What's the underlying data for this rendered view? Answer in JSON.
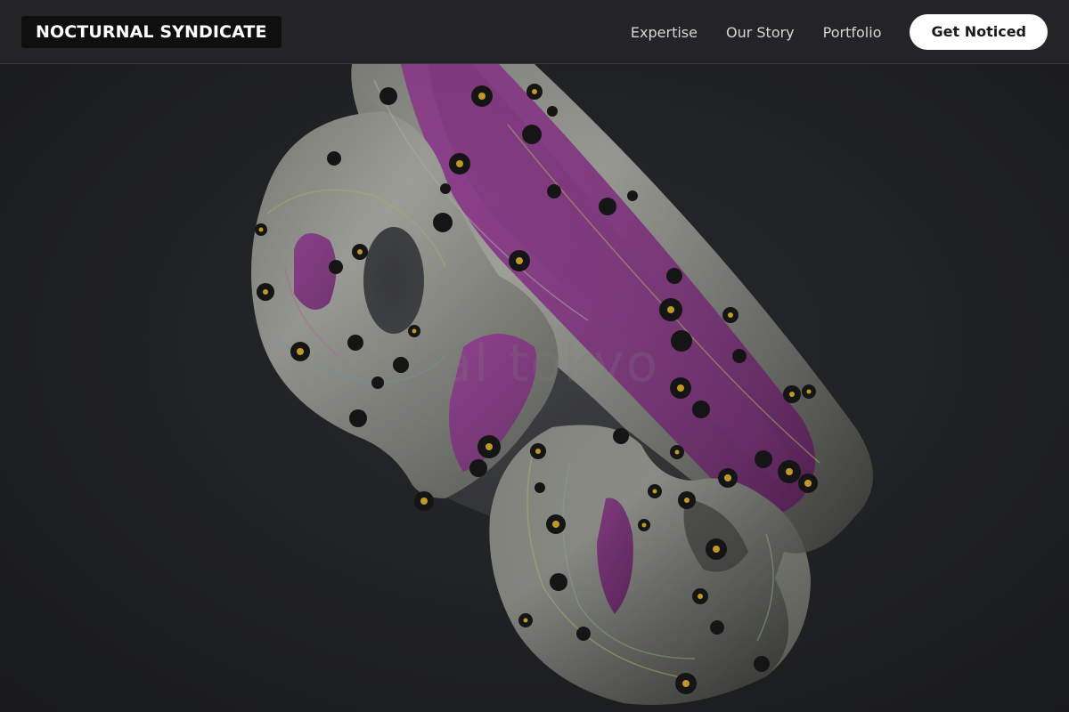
{
  "header": {
    "logo": "NOCTURNAL SYNDICATE",
    "nav": [
      "Expertise",
      "Our Story",
      "Portfolio"
    ],
    "cta": "Get Noticed"
  },
  "hero": {
    "watermark": "kal tokyo"
  },
  "colors": {
    "header_bg": "#242426",
    "logo_bg": "#0f0f10",
    "cta_bg": "#ffffff",
    "page_bg": "#25272b",
    "sculpture_accent": "#9b2a9a",
    "dot_yellow": "#e3b62a"
  }
}
